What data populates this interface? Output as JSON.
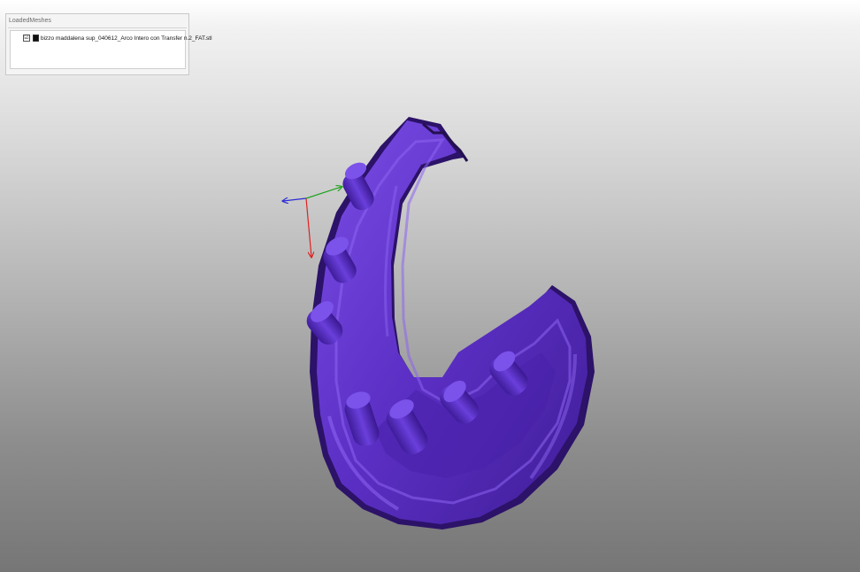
{
  "panel": {
    "title": "LoadedMeshes",
    "meshes": [
      {
        "name": "bizzo maddalena sup_040612_Arco Intero con Transfer n.2_FAT.stl",
        "checked": true,
        "check_glyph": "☑"
      }
    ]
  },
  "viewport": {
    "mesh_color": "#5b2fc4",
    "mesh_shadow_color": "#2c1268",
    "mesh_highlight_color": "#8d63f0",
    "axis_colors": {
      "x": "#e02020",
      "y": "#1fa31f",
      "z": "#2b2bd6"
    }
  }
}
